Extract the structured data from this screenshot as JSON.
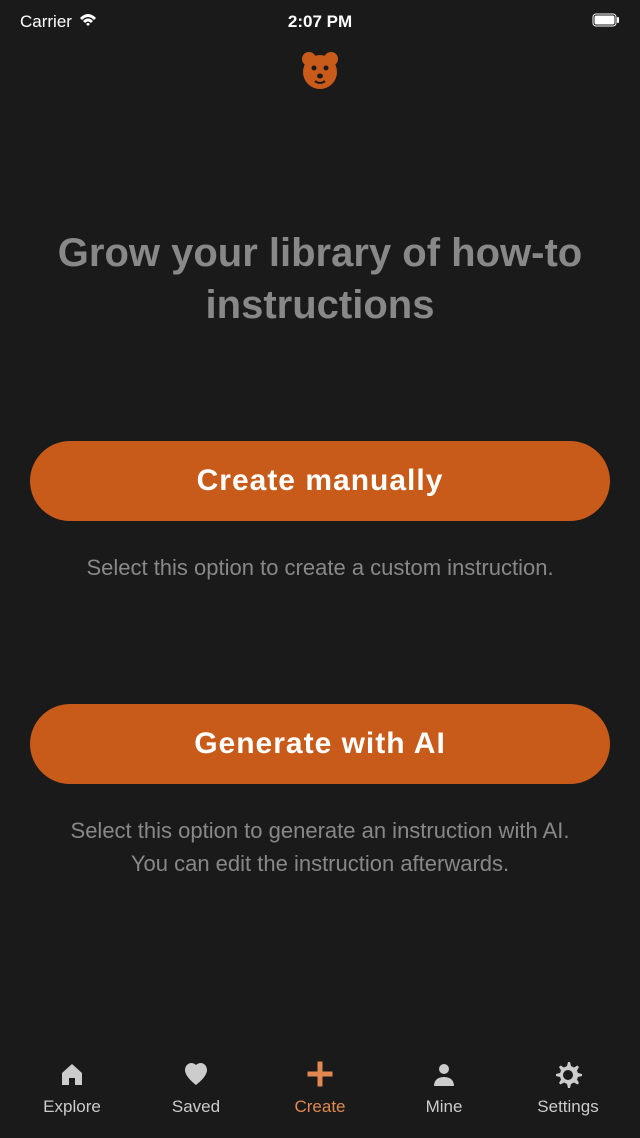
{
  "statusBar": {
    "carrier": "Carrier",
    "time": "2:07 PM"
  },
  "heading": "Grow your library of how-to instructions",
  "options": {
    "manual": {
      "button": "Create manually",
      "desc": "Select this option to create a custom instruction."
    },
    "ai": {
      "button": "Generate with AI",
      "desc": "Select this option to generate an instruction with AI. You can edit the instruction afterwards."
    }
  },
  "tabs": {
    "explore": "Explore",
    "saved": "Saved",
    "create": "Create",
    "mine": "Mine",
    "settings": "Settings"
  },
  "colors": {
    "accent": "#c85a1a",
    "activeTab": "#e08850",
    "bg": "#1a1a1a",
    "muted": "#888"
  }
}
